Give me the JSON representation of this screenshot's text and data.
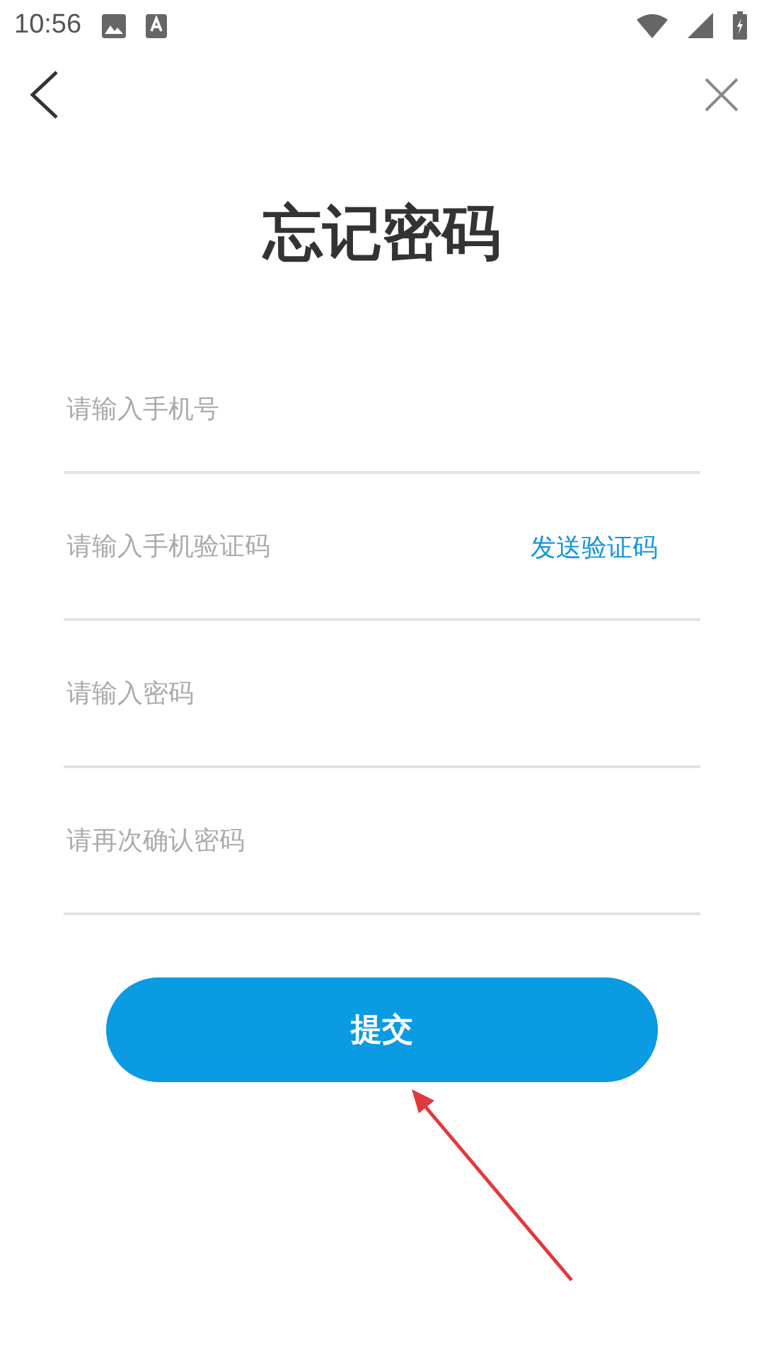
{
  "status_bar": {
    "time": "10:56"
  },
  "title": "忘记密码",
  "fields": [
    {
      "placeholder": "请输入手机号"
    },
    {
      "placeholder": "请输入手机验证码",
      "action": "发送验证码"
    },
    {
      "placeholder": "请输入密码"
    },
    {
      "placeholder": "请再次确认密码"
    }
  ],
  "submit": "提交"
}
